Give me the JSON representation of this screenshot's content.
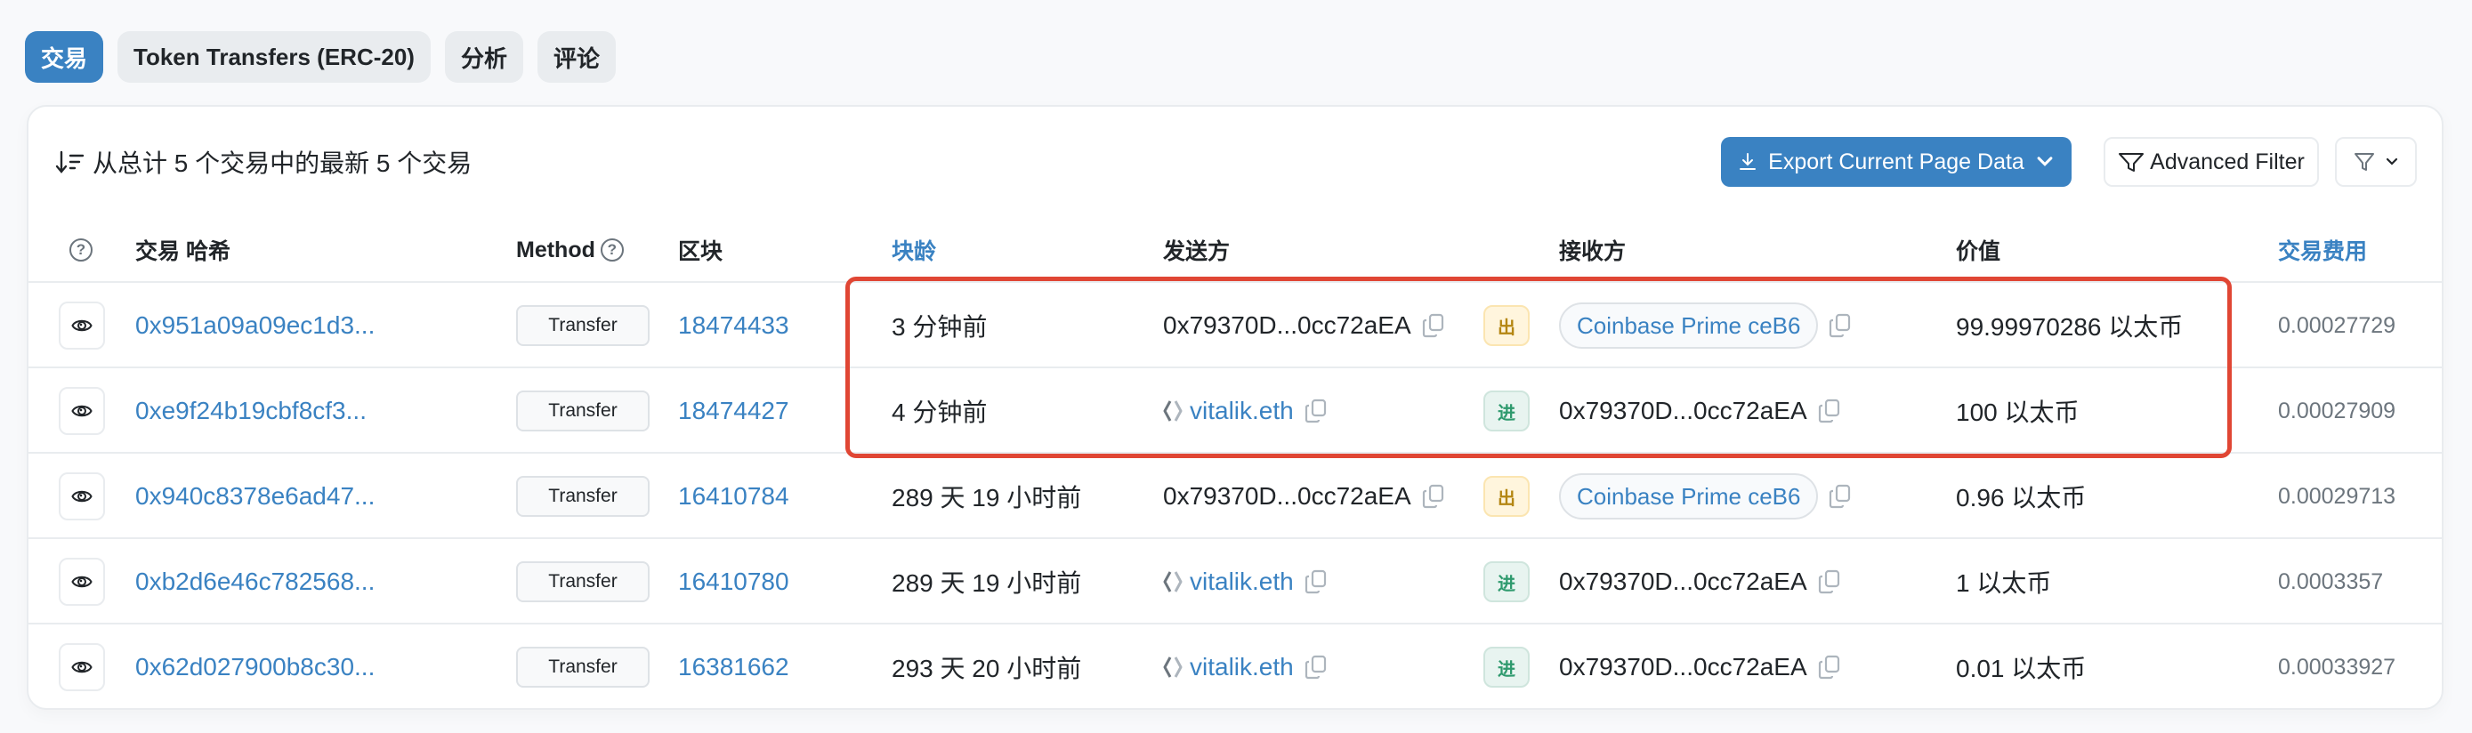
{
  "tabs": [
    {
      "label": "交易",
      "active": true
    },
    {
      "label": "Token Transfers (ERC-20)",
      "active": false
    },
    {
      "label": "分析",
      "active": false
    },
    {
      "label": "评论",
      "active": false
    }
  ],
  "summary": {
    "icon": "sort-desc-icon",
    "text": "从总计 5 个交易中的最新 5 个交易"
  },
  "toolbar": {
    "export_label": "Export Current Page Data",
    "advanced_filter_label": "Advanced Filter"
  },
  "columns": {
    "tx_hash": "交易 哈希",
    "method": "Method",
    "block": "区块",
    "age": "块龄",
    "from": "发送方",
    "to": "接收方",
    "value": "价值",
    "fee": "交易费用"
  },
  "rows": [
    {
      "hash": "0x951a09a09ec1d3...",
      "method": "Transfer",
      "block": "18474433",
      "age": "3 分钟前",
      "from": "0x79370D...0cc72aEA",
      "from_ens": false,
      "direction": "出",
      "direction_type": "out",
      "to": "Coinbase Prime ceB6",
      "to_labeled": true,
      "value": "99.99970286 以太币",
      "fee": "0.00027729"
    },
    {
      "hash": "0xe9f24b19cbf8cf3...",
      "method": "Transfer",
      "block": "18474427",
      "age": "4 分钟前",
      "from": "vitalik.eth",
      "from_ens": true,
      "direction": "进",
      "direction_type": "in",
      "to": "0x79370D...0cc72aEA",
      "to_labeled": false,
      "value": "100 以太币",
      "fee": "0.00027909"
    },
    {
      "hash": "0x940c8378e6ad47...",
      "method": "Transfer",
      "block": "16410784",
      "age": "289 天 19 小时前",
      "from": "0x79370D...0cc72aEA",
      "from_ens": false,
      "direction": "出",
      "direction_type": "out",
      "to": "Coinbase Prime ceB6",
      "to_labeled": true,
      "value": "0.96 以太币",
      "fee": "0.00029713"
    },
    {
      "hash": "0xb2d6e46c782568...",
      "method": "Transfer",
      "block": "16410780",
      "age": "289 天 19 小时前",
      "from": "vitalik.eth",
      "from_ens": true,
      "direction": "进",
      "direction_type": "in",
      "to": "0x79370D...0cc72aEA",
      "to_labeled": false,
      "value": "1 以太币",
      "fee": "0.0003357"
    },
    {
      "hash": "0x62d027900b8c30...",
      "method": "Transfer",
      "block": "16381662",
      "age": "293 天 20 小时前",
      "from": "vitalik.eth",
      "from_ens": true,
      "direction": "进",
      "direction_type": "in",
      "to": "0x79370D...0cc72aEA",
      "to_labeled": false,
      "value": "0.01 以太币",
      "fee": "0.00033927"
    }
  ],
  "colors": {
    "accent": "#3a82c2",
    "highlight": "#e04634",
    "out_badge": "#b48612",
    "in_badge": "#2f9a6e"
  }
}
